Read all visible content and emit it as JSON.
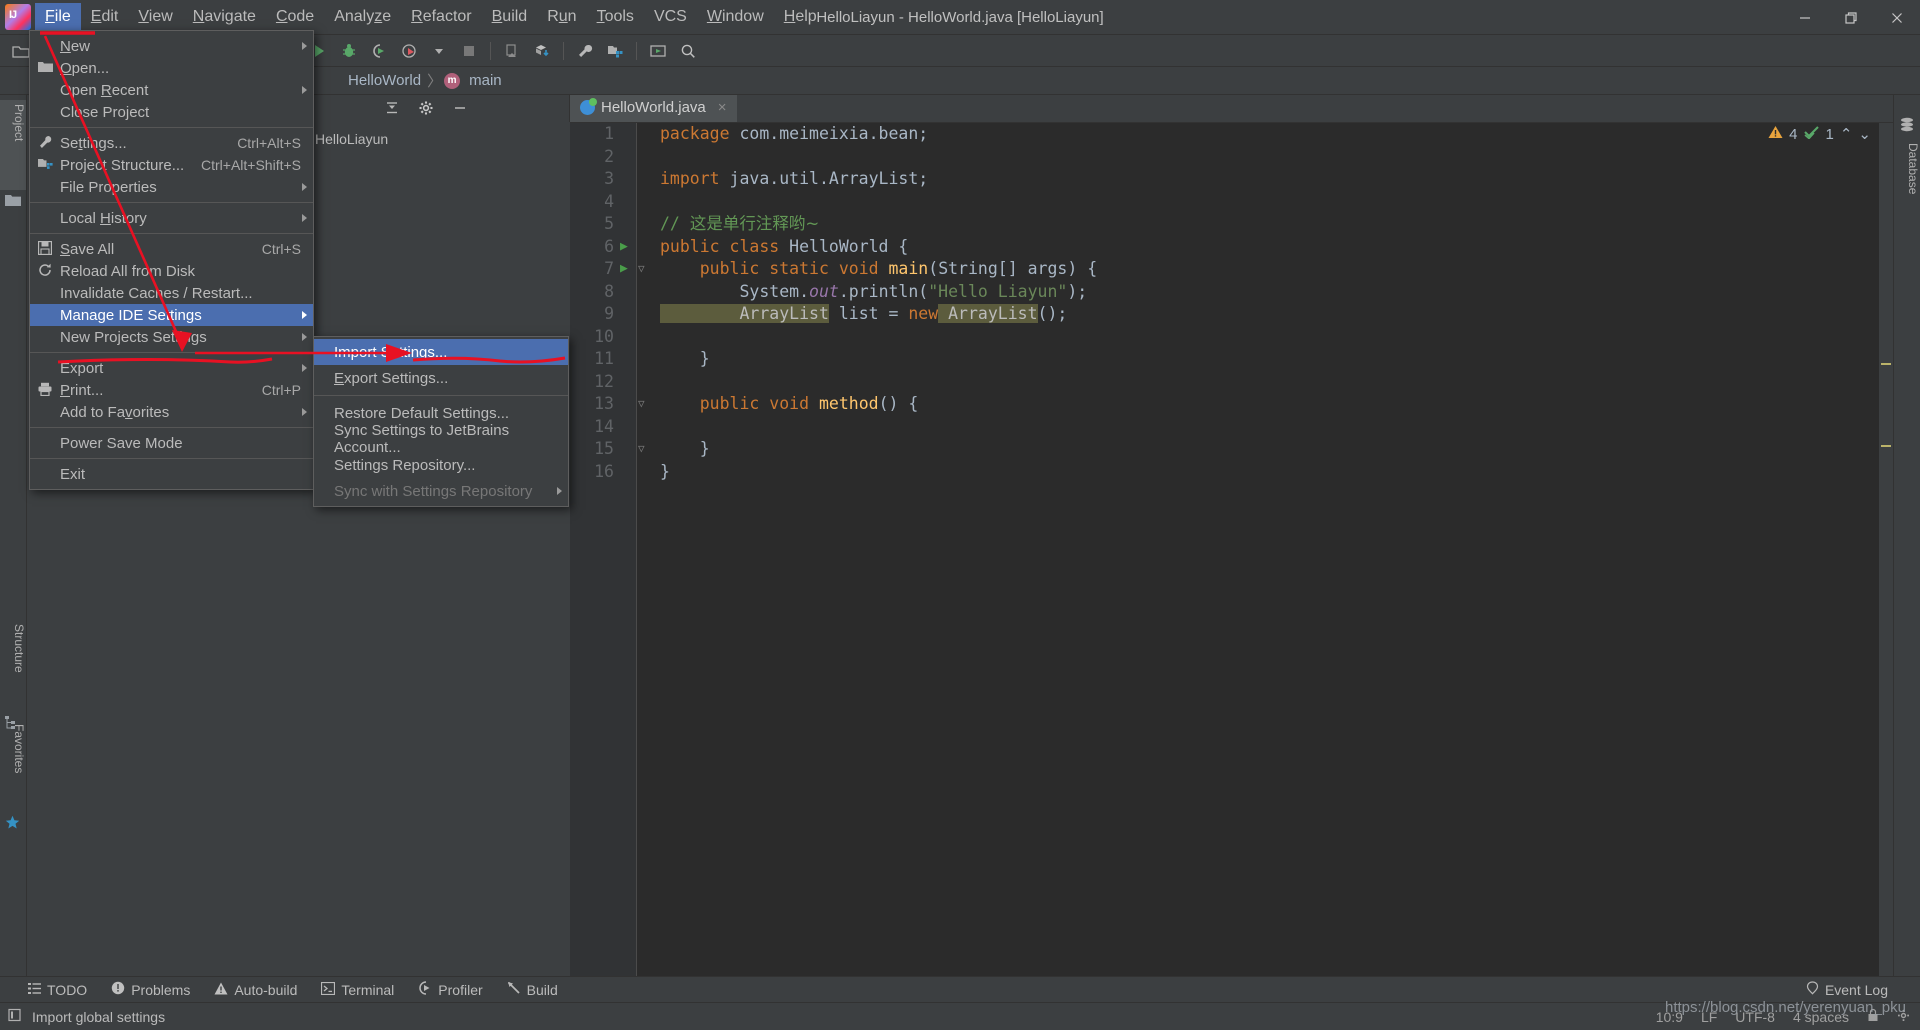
{
  "window": {
    "title": "HelloLiayun - HelloWorld.java [HelloLiayun]",
    "minimize": "minimize-icon",
    "maximize": "maximize-icon",
    "close": "close-icon"
  },
  "menubar": {
    "items": [
      {
        "label": "File",
        "mnemonic": "F",
        "active": true
      },
      {
        "label": "Edit",
        "mnemonic": "E",
        "active": false
      },
      {
        "label": "View",
        "mnemonic": "V",
        "active": false
      },
      {
        "label": "Navigate",
        "mnemonic": "N",
        "active": false
      },
      {
        "label": "Code",
        "mnemonic": "C",
        "active": false
      },
      {
        "label": "Analyze",
        "mnemonic": "z",
        "active": false
      },
      {
        "label": "Refactor",
        "mnemonic": "R",
        "active": false
      },
      {
        "label": "Build",
        "mnemonic": "B",
        "active": false
      },
      {
        "label": "Run",
        "mnemonic": "u",
        "active": false
      },
      {
        "label": "Tools",
        "mnemonic": "T",
        "active": false
      },
      {
        "label": "VCS",
        "mnemonic": "",
        "active": false
      },
      {
        "label": "Window",
        "mnemonic": "W",
        "active": false
      },
      {
        "label": "Help",
        "mnemonic": "H",
        "active": false
      }
    ]
  },
  "file_menu": {
    "items": [
      {
        "label": "New",
        "mnemonic": "N",
        "accel": "",
        "icon": "",
        "arrow": true,
        "highlight": false,
        "disabled": false
      },
      {
        "label": "Open...",
        "mnemonic": "O",
        "accel": "",
        "icon": "folder-open-icon",
        "arrow": false,
        "highlight": false,
        "disabled": false
      },
      {
        "label": "Open Recent",
        "mnemonic": "R",
        "accel": "",
        "icon": "",
        "arrow": true,
        "highlight": false,
        "disabled": false
      },
      {
        "label": "Close Project",
        "mnemonic": "",
        "accel": "",
        "icon": "",
        "arrow": false,
        "highlight": false,
        "disabled": false
      },
      {
        "separator": true
      },
      {
        "label": "Settings...",
        "mnemonic": "t",
        "accel": "Ctrl+Alt+S",
        "icon": "wrench-icon",
        "arrow": false,
        "highlight": false,
        "disabled": false
      },
      {
        "label": "Project Structure...",
        "mnemonic": "",
        "accel": "Ctrl+Alt+Shift+S",
        "icon": "project-structure-icon",
        "arrow": false,
        "highlight": false,
        "disabled": false
      },
      {
        "label": "File Properties",
        "mnemonic": "",
        "accel": "",
        "icon": "",
        "arrow": true,
        "highlight": false,
        "disabled": false
      },
      {
        "separator": true
      },
      {
        "label": "Local History",
        "mnemonic": "H",
        "accel": "",
        "icon": "",
        "arrow": true,
        "highlight": false,
        "disabled": false
      },
      {
        "separator": true
      },
      {
        "label": "Save All",
        "mnemonic": "S",
        "accel": "Ctrl+S",
        "icon": "save-icon",
        "arrow": false,
        "highlight": false,
        "disabled": false
      },
      {
        "label": "Reload All from Disk",
        "mnemonic": "",
        "accel": "",
        "icon": "reload-icon",
        "arrow": false,
        "highlight": false,
        "disabled": false
      },
      {
        "label": "Invalidate Caches / Restart...",
        "mnemonic": "",
        "accel": "",
        "icon": "",
        "arrow": false,
        "highlight": false,
        "disabled": false
      },
      {
        "label": "Manage IDE Settings",
        "mnemonic": "",
        "accel": "",
        "icon": "",
        "arrow": true,
        "highlight": true,
        "disabled": false
      },
      {
        "label": "New Projects Settings",
        "mnemonic": "",
        "accel": "",
        "icon": "",
        "arrow": true,
        "highlight": false,
        "disabled": false
      },
      {
        "separator": true
      },
      {
        "label": "Export",
        "mnemonic": "",
        "accel": "",
        "icon": "",
        "arrow": true,
        "highlight": false,
        "disabled": false
      },
      {
        "label": "Print...",
        "mnemonic": "P",
        "accel": "Ctrl+P",
        "icon": "print-icon",
        "arrow": false,
        "highlight": false,
        "disabled": false
      },
      {
        "label": "Add to Favorites",
        "mnemonic": "v",
        "accel": "",
        "icon": "",
        "arrow": true,
        "highlight": false,
        "disabled": false
      },
      {
        "separator": true
      },
      {
        "label": "Power Save Mode",
        "mnemonic": "",
        "accel": "",
        "icon": "",
        "arrow": false,
        "highlight": false,
        "disabled": false
      },
      {
        "separator": true
      },
      {
        "label": "Exit",
        "mnemonic": "",
        "accel": "",
        "icon": "",
        "arrow": false,
        "highlight": false,
        "disabled": false
      }
    ]
  },
  "manage_ide_settings_submenu": {
    "items": [
      {
        "label": "Import Settings...",
        "mnemonic": "",
        "arrow": false,
        "highlight": true,
        "disabled": false
      },
      {
        "label": "Export Settings...",
        "mnemonic": "E",
        "arrow": false,
        "highlight": false,
        "disabled": false
      },
      {
        "separator": true
      },
      {
        "label": "Restore Default Settings...",
        "mnemonic": "",
        "arrow": false,
        "highlight": false,
        "disabled": false
      },
      {
        "label": "Sync Settings to JetBrains Account...",
        "mnemonic": "",
        "arrow": false,
        "highlight": false,
        "disabled": false
      },
      {
        "label": "Settings Repository...",
        "mnemonic": "",
        "arrow": false,
        "highlight": false,
        "disabled": false
      },
      {
        "label": "Sync with Settings Repository",
        "mnemonic": "",
        "arrow": true,
        "highlight": false,
        "disabled": true
      }
    ]
  },
  "toolbar": {
    "icons": [
      "open-folder-icon",
      "run-icon",
      "debug-icon",
      "run-coverage-icon",
      "profile-icon",
      "dropdown-icon",
      "stop-icon",
      "device-icon",
      "sync-gradle-icon",
      "settings-wrench-icon",
      "project-structure-icon",
      "select-target-icon",
      "search-everywhere-icon"
    ]
  },
  "breadcrumb": {
    "project": "HelloWorld",
    "separator": "〉",
    "method": "main",
    "method_badge": "m"
  },
  "left_rail": {
    "items": [
      {
        "label": "Project",
        "icon": "folder-icon",
        "selected": true
      },
      {
        "label": "Structure",
        "icon": "structure-icon",
        "selected": false
      },
      {
        "label": "Favorites",
        "icon": "star-icon",
        "selected": false
      }
    ]
  },
  "right_rail": {
    "items": [
      {
        "label": "Database",
        "icon": "database-icon",
        "selected": false
      }
    ]
  },
  "project_panel": {
    "tools": [
      "collapse-all-icon",
      "gear-icon",
      "hide-icon"
    ],
    "tree": [
      {
        "label": "HelloLiayun",
        "selected": false
      }
    ]
  },
  "editor": {
    "tab": {
      "label": "HelloWorld.java",
      "icon": "java-class-icon",
      "close": "×"
    },
    "inspection": {
      "warning_count": "4",
      "warning_icon": "warning-triangle-icon",
      "ok_count": "1",
      "ok_icon": "green-check-icon",
      "prev": "⌃",
      "next": "⌄"
    },
    "lines": [
      {
        "num": "1",
        "run": false,
        "fold": false,
        "tokens": [
          {
            "t": "package",
            "c": "kw"
          },
          {
            "t": " com.meimeixia.bean;",
            "c": "plain"
          }
        ]
      },
      {
        "num": "2",
        "run": false,
        "fold": false,
        "tokens": []
      },
      {
        "num": "3",
        "run": false,
        "fold": false,
        "tokens": [
          {
            "t": "import",
            "c": "kw"
          },
          {
            "t": " java.util.ArrayList;",
            "c": "plain"
          }
        ]
      },
      {
        "num": "4",
        "run": false,
        "fold": false,
        "tokens": []
      },
      {
        "num": "5",
        "run": false,
        "fold": false,
        "tokens": [
          {
            "t": "// ",
            "c": "cmt"
          },
          {
            "t": "这是单行注释哟~",
            "c": "cmt-cn"
          }
        ]
      },
      {
        "num": "6",
        "run": true,
        "fold": false,
        "tokens": [
          {
            "t": "public class",
            "c": "kw"
          },
          {
            "t": " ",
            "c": "plain"
          },
          {
            "t": "HelloWorld",
            "c": "plain"
          },
          {
            "t": " {",
            "c": "plain"
          }
        ]
      },
      {
        "num": "7",
        "run": true,
        "fold": true,
        "tokens": [
          {
            "t": "    ",
            "c": "plain"
          },
          {
            "t": "public static void",
            "c": "kw"
          },
          {
            "t": " ",
            "c": "plain"
          },
          {
            "t": "main",
            "c": "mth"
          },
          {
            "t": "(",
            "c": "plain"
          },
          {
            "t": "String",
            "c": "plain"
          },
          {
            "t": "[] args) {",
            "c": "plain"
          }
        ]
      },
      {
        "num": "8",
        "run": false,
        "fold": false,
        "tokens": [
          {
            "t": "        System.",
            "c": "plain"
          },
          {
            "t": "out",
            "c": "fld"
          },
          {
            "t": ".println(",
            "c": "plain"
          },
          {
            "t": "\"Hello Liayun\"",
            "c": "str"
          },
          {
            "t": ");",
            "c": "plain"
          }
        ]
      },
      {
        "num": "9",
        "run": false,
        "fold": false,
        "tokens": [
          {
            "t": "        ArrayList",
            "c": "hl"
          },
          {
            "t": " list = ",
            "c": "plain"
          },
          {
            "t": "new",
            "c": "kw"
          },
          {
            "t": " ArrayList",
            "c": "hl"
          },
          {
            "t": "();",
            "c": "plain"
          }
        ]
      },
      {
        "num": "10",
        "run": false,
        "fold": false,
        "tokens": []
      },
      {
        "num": "11",
        "run": false,
        "fold": false,
        "tokens": [
          {
            "t": "    }",
            "c": "plain"
          }
        ]
      },
      {
        "num": "12",
        "run": false,
        "fold": false,
        "tokens": []
      },
      {
        "num": "13",
        "run": false,
        "fold": true,
        "tokens": [
          {
            "t": "    ",
            "c": "plain"
          },
          {
            "t": "public void",
            "c": "kw"
          },
          {
            "t": " ",
            "c": "plain"
          },
          {
            "t": "method",
            "c": "mth"
          },
          {
            "t": "() {",
            "c": "plain"
          }
        ]
      },
      {
        "num": "14",
        "run": false,
        "fold": false,
        "tokens": []
      },
      {
        "num": "15",
        "run": false,
        "fold": true,
        "tokens": [
          {
            "t": "    }",
            "c": "plain"
          }
        ]
      },
      {
        "num": "16",
        "run": false,
        "fold": false,
        "tokens": [
          {
            "t": "}",
            "c": "plain"
          }
        ]
      }
    ]
  },
  "tool_windows": {
    "items": [
      {
        "label": "TODO",
        "icon": "todo-list-icon"
      },
      {
        "label": "Problems",
        "icon": "problems-icon"
      },
      {
        "label": "Auto-build",
        "icon": "auto-build-icon"
      },
      {
        "label": "Terminal",
        "icon": "terminal-icon"
      },
      {
        "label": "Profiler",
        "icon": "profiler-icon"
      },
      {
        "label": "Build",
        "icon": "build-hammer-icon"
      }
    ],
    "event_log": {
      "label": "Event Log",
      "icon": "event-log-icon"
    }
  },
  "status_bar": {
    "message": "Import global settings",
    "message_icon": "info-icon",
    "caret": "10:9",
    "line_separator": "LF",
    "encoding": "UTF-8",
    "indent": "4 spaces",
    "lock_icon": "lock-icon",
    "gear_icon": "gear-icon"
  },
  "watermark": "https://blog.csdn.net/yerenyuan_pku",
  "colors": {
    "accent_highlight": "#4b6eaf",
    "annotation_red": "#e81123",
    "bg_chrome": "#3c3f41",
    "bg_editor": "#2b2b2b",
    "warning_yellow": "#e8a33d"
  }
}
